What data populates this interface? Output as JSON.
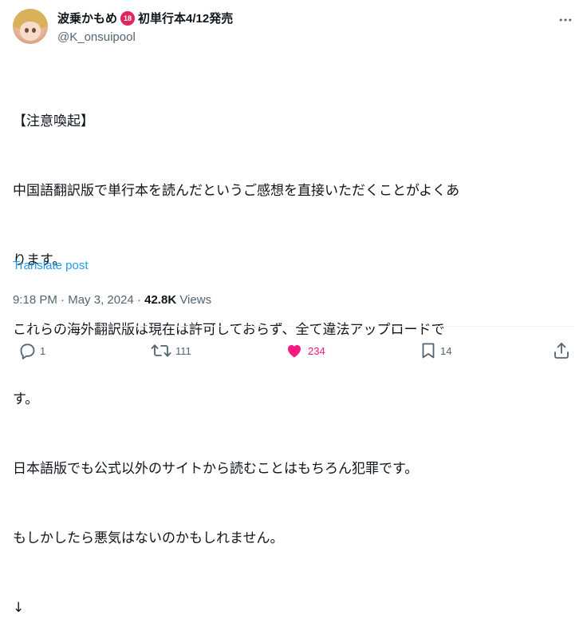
{
  "author": {
    "display_name_prefix": "波乗かもめ",
    "badge_text": "18",
    "display_name_suffix": "初単行本4/12発売",
    "handle": "@K_onsuipool"
  },
  "post": {
    "lines": [
      "【注意喚起】",
      "中国語翻訳版で単行本を読んだというご感想を直接いただくことがよくあ",
      "ります。",
      "これらの海外翻訳版は現在は許可しておらず、全て違法アップロードで",
      "す。",
      "日本語版でも公式以外のサイトから読むことはもちろん犯罪です。",
      "もしかしたら悪気はないのかもしれません。",
      "↓"
    ],
    "translate_label": "Translate post",
    "time": "9:18 PM",
    "separator": " · ",
    "date": "May 3, 2024",
    "views_count": "42.8K",
    "views_label": "Views"
  },
  "actions": {
    "replies": "1",
    "reposts": "111",
    "likes": "234",
    "bookmarks": "14"
  },
  "colors": {
    "text": "#0f1419",
    "secondary": "#536471",
    "link": "#1d9bf0",
    "like": "#f91880",
    "divider": "#eff3f4"
  },
  "icons": [
    "more-icon",
    "reply-icon",
    "repost-icon",
    "like-icon",
    "bookmark-icon",
    "share-icon"
  ]
}
